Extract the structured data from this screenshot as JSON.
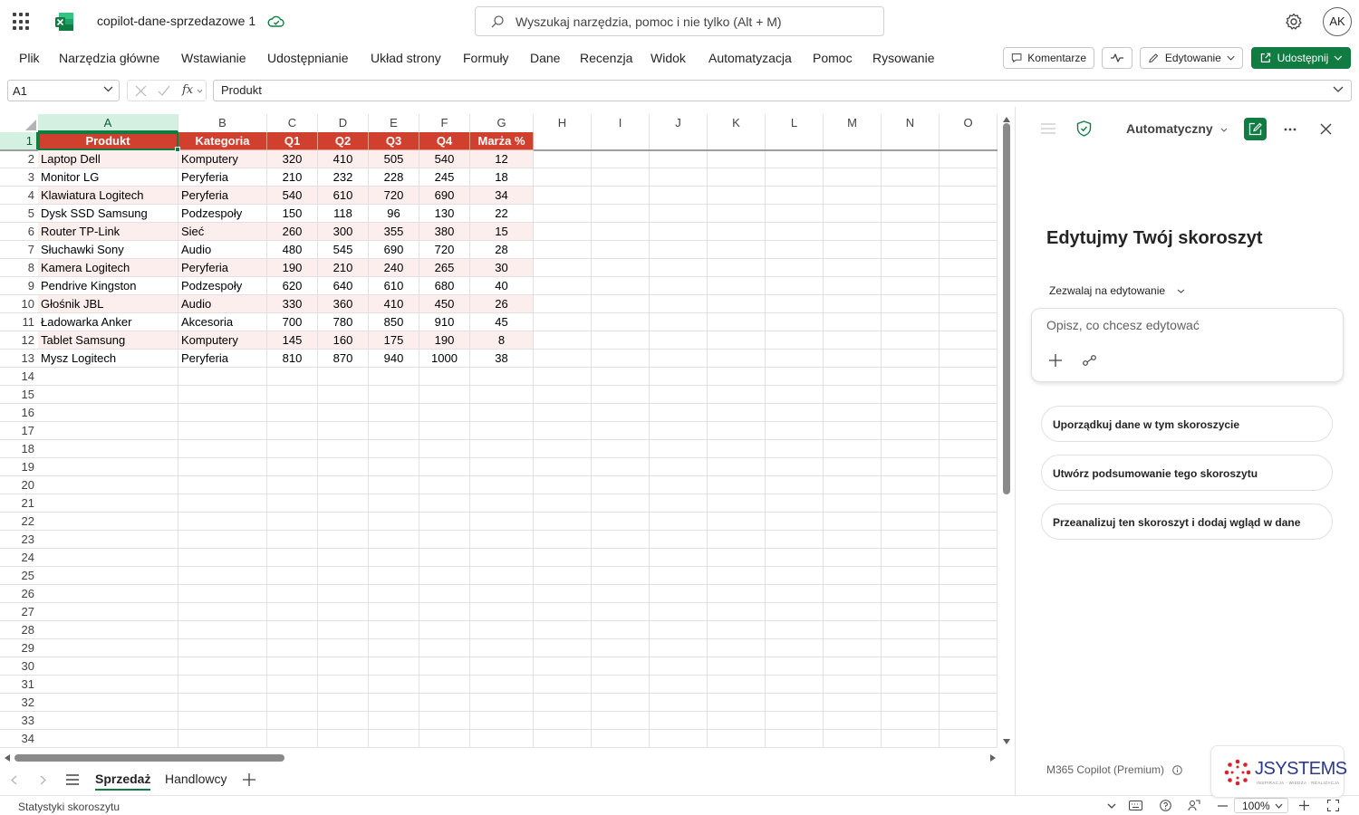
{
  "app": {
    "document_title": "copilot-dane-sprzedazowe 1",
    "avatar_initials": "AK",
    "brand_color": "#107c41"
  },
  "search": {
    "placeholder": "Wyszukaj narzędzia, pomoc i nie tylko (Alt + M)"
  },
  "ribbon": {
    "tabs": [
      "Plik",
      "Narzędzia główne",
      "Wstawianie",
      "Udostępnianie",
      "Układ strony",
      "Formuły",
      "Dane",
      "Recenzja",
      "Widok",
      "Automatyzacja",
      "Pomoc",
      "Rysowanie"
    ],
    "comments_label": "Komentarze",
    "editing_label": "Edytowanie",
    "share_label": "Udostępnij"
  },
  "formula_bar": {
    "name_box": "A1",
    "formula": "Produkt",
    "fx_label": "fx"
  },
  "grid": {
    "columns": [
      "A",
      "B",
      "C",
      "D",
      "E",
      "F",
      "G",
      "H",
      "I",
      "J",
      "K",
      "L",
      "M",
      "N",
      "O"
    ],
    "rows": [
      "1",
      "2",
      "3",
      "4",
      "5",
      "6",
      "7",
      "8",
      "9",
      "10",
      "11",
      "12",
      "13",
      "14",
      "15",
      "16",
      "17",
      "18",
      "19",
      "20",
      "21",
      "22",
      "23",
      "24",
      "25",
      "26",
      "27",
      "28",
      "29",
      "30",
      "31",
      "32",
      "33",
      "34"
    ],
    "selected_cell": "A1",
    "header_fill": "#d13f2f",
    "band_fill": "#fbeeec",
    "header": [
      "Produkt",
      "Kategoria",
      "Q1",
      "Q2",
      "Q3",
      "Q4",
      "Marża %"
    ],
    "data": [
      [
        "Laptop Dell",
        "Komputery",
        "320",
        "410",
        "505",
        "540",
        "12"
      ],
      [
        "Monitor LG",
        "Peryferia",
        "210",
        "232",
        "228",
        "245",
        "18"
      ],
      [
        "Klawiatura Logitech",
        "Peryferia",
        "540",
        "610",
        "720",
        "690",
        "34"
      ],
      [
        "Dysk SSD Samsung",
        "Podzespoły",
        "150",
        "118",
        "96",
        "130",
        "22"
      ],
      [
        "Router TP-Link",
        "Sieć",
        "260",
        "300",
        "355",
        "380",
        "15"
      ],
      [
        "Słuchawki Sony",
        "Audio",
        "480",
        "545",
        "690",
        "720",
        "28"
      ],
      [
        "Kamera Logitech",
        "Peryferia",
        "190",
        "210",
        "240",
        "265",
        "30"
      ],
      [
        "Pendrive Kingston",
        "Podzespoły",
        "620",
        "640",
        "610",
        "680",
        "40"
      ],
      [
        "Głośnik JBL",
        "Audio",
        "330",
        "360",
        "410",
        "450",
        "26"
      ],
      [
        "Ładowarka Anker",
        "Akcesoria",
        "700",
        "780",
        "850",
        "910",
        "45"
      ],
      [
        "Tablet Samsung",
        "Komputery",
        "145",
        "160",
        "175",
        "190",
        "8"
      ],
      [
        "Mysz Logitech",
        "Peryferia",
        "810",
        "870",
        "940",
        "1000",
        "38"
      ]
    ]
  },
  "sheets": {
    "tabs": [
      "Sprzedaż",
      "Handlowcy"
    ],
    "active": "Sprzedaż"
  },
  "status": {
    "text": "Statystyki skoroszytu",
    "zoom": "100%"
  },
  "copilot": {
    "mode": "Automatyczny",
    "heading": "Edytujmy Twój skoroszyt",
    "permission": "Zezwalaj na edytowanie",
    "input_placeholder": "Opisz, co chcesz edytować",
    "suggestions": [
      "Uporządkuj dane w tym skoroszycie",
      "Utwórz podsumowanie tego skoroszytu",
      "Przeanalizuj ten skoroszyt i dodaj wgląd w dane"
    ],
    "plan": "M365 Copilot (Premium)",
    "partner_logo": "JSYSTEMS",
    "partner_tagline": "INSPIRACJA · WIEDZA · REALIZACJA"
  }
}
